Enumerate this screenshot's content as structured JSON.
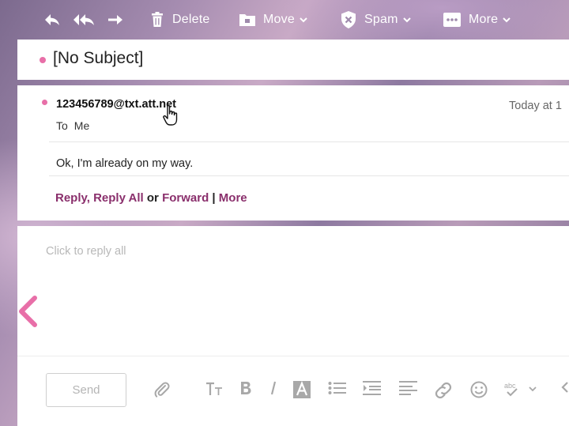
{
  "toolbar": {
    "delete_label": "Delete",
    "move_label": "Move",
    "spam_label": "Spam",
    "more_label": "More"
  },
  "message": {
    "subject": "[No Subject]",
    "sender": "123456789@txt.att.net",
    "date": "Today at 1",
    "to_label": "To",
    "to_value": "Me",
    "body": "Ok, I'm already on my way.",
    "actions": {
      "reply": "Reply,",
      "reply_all": "Reply All",
      "or": "or",
      "forward": "Forward",
      "pipe": "|",
      "more": "More"
    }
  },
  "compose": {
    "placeholder": "Click to reply all",
    "send_label": "Send"
  },
  "colors": {
    "accent_pink": "#e86fa8",
    "link_purple": "#8a2f6c"
  },
  "icons": [
    "reply-icon",
    "reply-all-icon",
    "forward-icon",
    "trash-icon",
    "folder-icon",
    "shield-icon",
    "more-dots-icon",
    "paperclip-icon",
    "font-size-icon",
    "bold-icon",
    "italic-icon",
    "text-color-icon",
    "bullet-list-icon",
    "indent-icon",
    "align-icon",
    "link-icon",
    "emoji-icon",
    "spellcheck-icon",
    "chevron-left-icon",
    "hand-cursor-icon"
  ]
}
